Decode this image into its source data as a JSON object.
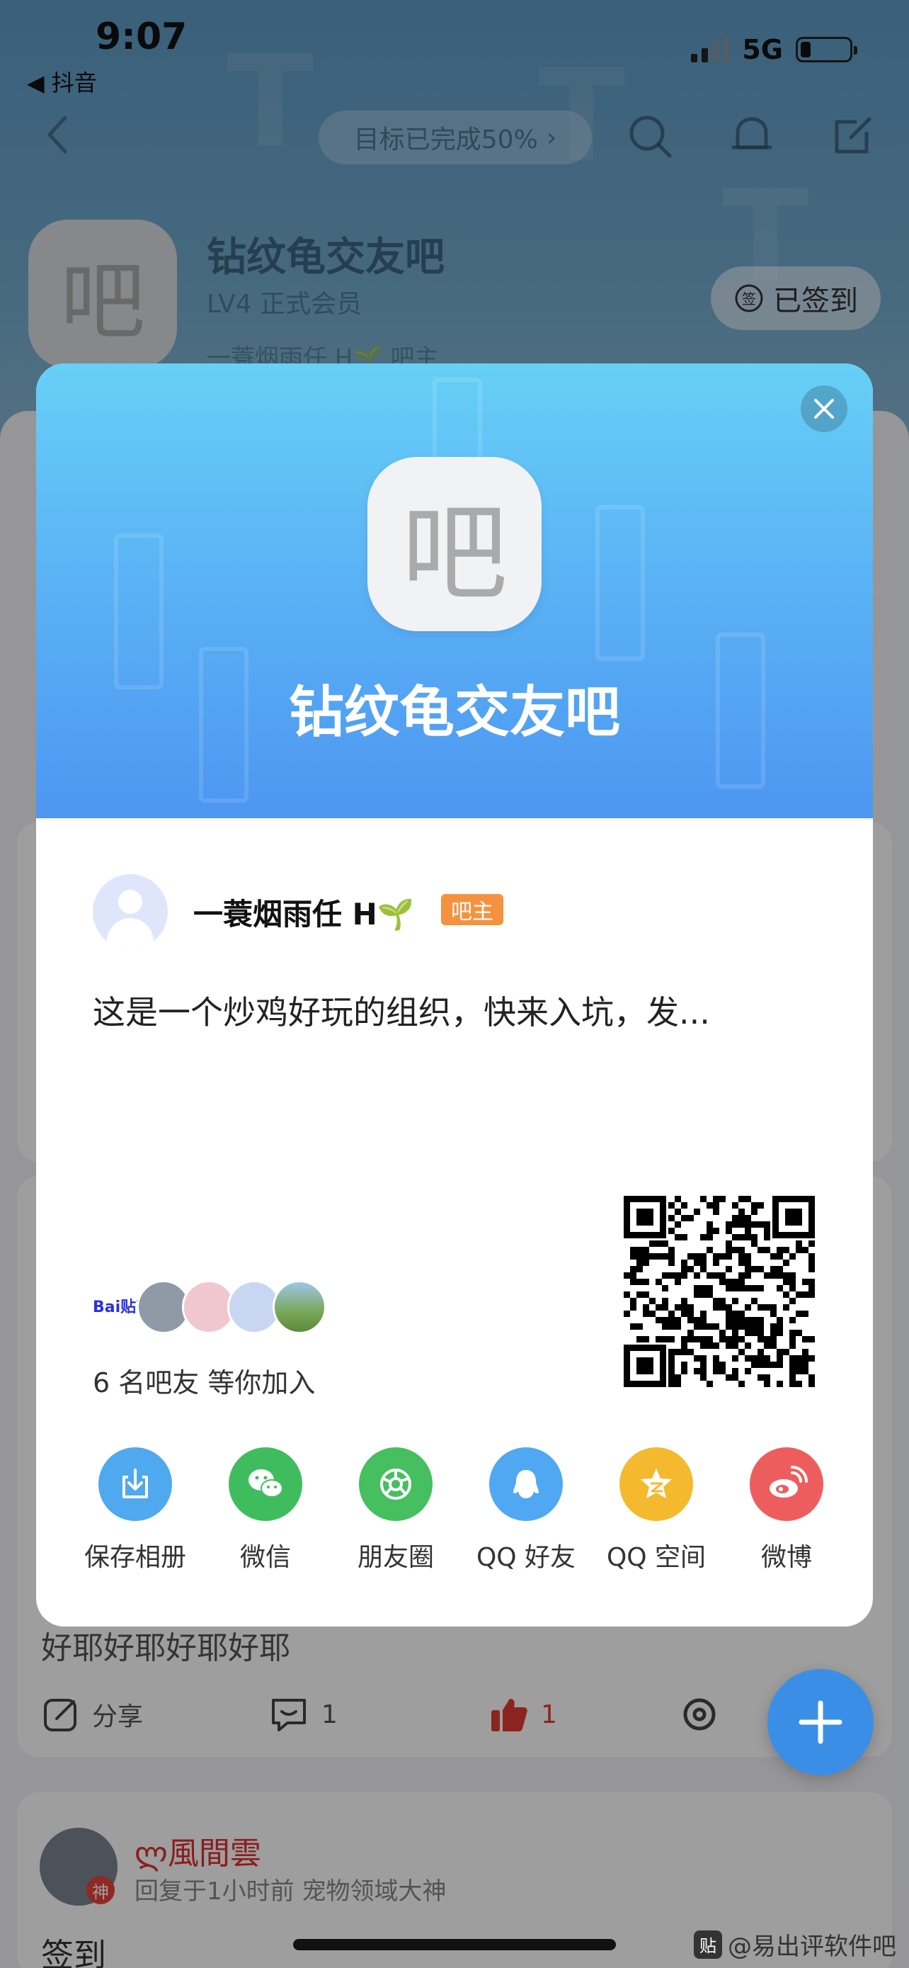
{
  "status_bar": {
    "time": "9:07",
    "back_app": "◀ 抖音",
    "network": "5G"
  },
  "nav": {
    "goal": "目标已完成50%",
    "goal_arrow": "›"
  },
  "forum": {
    "avatar_char": "吧",
    "name": "钻纹龟交友吧",
    "level": "LV4 正式会员",
    "owner_line": "一蓑烟雨任 H🌱 吧主",
    "signed_label": "已签到"
  },
  "background_post": {
    "text": "好耶好耶好耶好耶",
    "share_label": "分享",
    "comment_count": "1",
    "like_count": "1"
  },
  "background_reply": {
    "user_name": "ლ風間雲",
    "badge": "神",
    "meta": "回复于1小时前   宠物领域大神",
    "content": "签到"
  },
  "watermark": {
    "icon": "贴",
    "text": "@易出评软件吧"
  },
  "share_card": {
    "avatar_char": "吧",
    "title": "钻纹龟交友吧",
    "owner_name": "一蓑烟雨任 H🌱",
    "owner_badge": "吧主",
    "description": "这是一个炒鸡好玩的组织，快来入坑，发...",
    "friends_logo": "Bai贴吧",
    "friends_count": "6 名吧友 等你加入",
    "share_options": [
      {
        "label": "保存相册",
        "icon": "download-icon",
        "color": "#4ea9ef"
      },
      {
        "label": "微信",
        "icon": "wechat-icon",
        "color": "#3fbd5e"
      },
      {
        "label": "朋友圈",
        "icon": "moments-icon",
        "color": "#45bf5f"
      },
      {
        "label": "QQ 好友",
        "icon": "qq-icon",
        "color": "#50a8f2"
      },
      {
        "label": "QQ 空间",
        "icon": "qzone-icon",
        "color": "#f5b930"
      },
      {
        "label": "微博",
        "icon": "weibo-icon",
        "color": "#ee5d5d"
      }
    ]
  }
}
